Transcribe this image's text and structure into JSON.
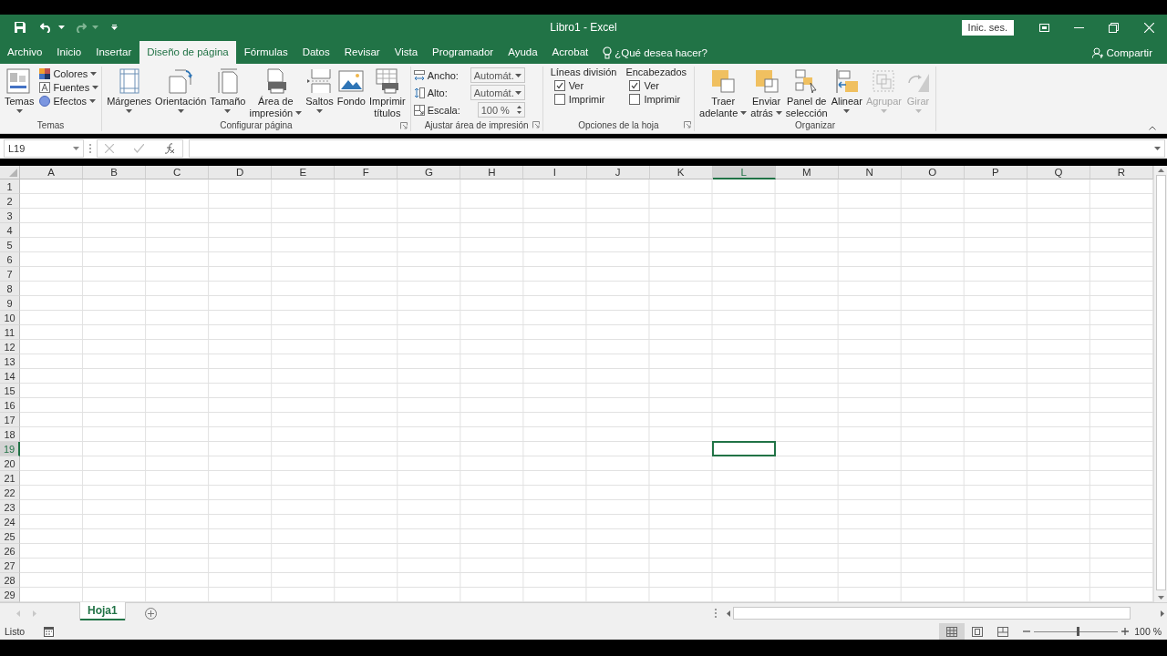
{
  "window": {
    "title": "Libro1 - Excel",
    "sign_in": "Inic. ses."
  },
  "tabs": [
    {
      "label": "Archivo",
      "selected": false
    },
    {
      "label": "Inicio",
      "selected": false
    },
    {
      "label": "Insertar",
      "selected": false
    },
    {
      "label": "Diseño de página",
      "selected": true
    },
    {
      "label": "Fórmulas",
      "selected": false
    },
    {
      "label": "Datos",
      "selected": false
    },
    {
      "label": "Revisar",
      "selected": false
    },
    {
      "label": "Vista",
      "selected": false
    },
    {
      "label": "Programador",
      "selected": false
    },
    {
      "label": "Ayuda",
      "selected": false
    },
    {
      "label": "Acrobat",
      "selected": false
    }
  ],
  "tell_me": "¿Qué desea hacer?",
  "share": "Compartir",
  "ribbon": {
    "groups": [
      {
        "label": "Temas",
        "launcher": false,
        "items": [
          {
            "kind": "large",
            "lines": [
              "Temas"
            ],
            "dropdown": true,
            "disabled": false
          },
          {
            "kind": "stack",
            "items": [
              {
                "label": "Colores",
                "dropdown": true
              },
              {
                "label": "Fuentes",
                "dropdown": true
              },
              {
                "label": "Efectos",
                "dropdown": true
              }
            ]
          }
        ]
      },
      {
        "label": "Configurar página",
        "launcher": true,
        "items": [
          {
            "kind": "large",
            "lines": [
              "Márgenes"
            ],
            "dropdown": true,
            "disabled": false
          },
          {
            "kind": "large",
            "lines": [
              "Orientación"
            ],
            "dropdown": true,
            "disabled": false
          },
          {
            "kind": "large",
            "lines": [
              "Tamaño"
            ],
            "dropdown": true,
            "disabled": false
          },
          {
            "kind": "large",
            "lines": [
              "Área de",
              "impresión"
            ],
            "dropdown": true,
            "disabled": false
          },
          {
            "kind": "large",
            "lines": [
              "Saltos"
            ],
            "dropdown": true,
            "disabled": false
          },
          {
            "kind": "large",
            "lines": [
              "Fondo"
            ],
            "dropdown": false,
            "disabled": false
          },
          {
            "kind": "large",
            "lines": [
              "Imprimir",
              "títulos"
            ],
            "dropdown": false,
            "disabled": false
          }
        ]
      },
      {
        "label": "Ajustar área de impresión",
        "launcher": true,
        "items": [
          {
            "kind": "fields",
            "items": [
              {
                "kind": "dropdown",
                "label": "Ancho:",
                "value": "Automát."
              },
              {
                "kind": "dropdown",
                "label": "Alto:",
                "value": "Automát."
              },
              {
                "kind": "spin",
                "label": "Escala:",
                "value": "100 %"
              }
            ]
          }
        ]
      },
      {
        "label": "Opciones de la hoja",
        "launcher": true,
        "items": [
          {
            "kind": "checks",
            "heading": "Líneas división",
            "checks": [
              {
                "label": "Ver",
                "checked": true
              },
              {
                "label": "Imprimir",
                "checked": false
              }
            ]
          },
          {
            "kind": "checks",
            "heading": "Encabezados",
            "checks": [
              {
                "label": "Ver",
                "checked": true
              },
              {
                "label": "Imprimir",
                "checked": false
              }
            ]
          }
        ]
      },
      {
        "label": "Organizar",
        "launcher": false,
        "items": [
          {
            "kind": "large",
            "lines": [
              "Traer",
              "adelante"
            ],
            "dropdown": true,
            "disabled": false
          },
          {
            "kind": "large",
            "lines": [
              "Enviar",
              "atrás"
            ],
            "dropdown": true,
            "disabled": false
          },
          {
            "kind": "large",
            "lines": [
              "Panel de",
              "selección"
            ],
            "dropdown": false,
            "disabled": false
          },
          {
            "kind": "large",
            "lines": [
              "Alinear"
            ],
            "dropdown": true,
            "disabled": false
          },
          {
            "kind": "large",
            "lines": [
              "Agrupar"
            ],
            "dropdown": true,
            "disabled": true
          },
          {
            "kind": "large",
            "lines": [
              "Girar"
            ],
            "dropdown": true,
            "disabled": true
          }
        ]
      }
    ]
  },
  "formula_bar": {
    "name_box": "L19"
  },
  "sheet": {
    "columns": [
      {
        "label": "A",
        "selected": false
      },
      {
        "label": "B",
        "selected": false
      },
      {
        "label": "C",
        "selected": false
      },
      {
        "label": "D",
        "selected": false
      },
      {
        "label": "E",
        "selected": false
      },
      {
        "label": "F",
        "selected": false
      },
      {
        "label": "G",
        "selected": false
      },
      {
        "label": "H",
        "selected": false
      },
      {
        "label": "I",
        "selected": false
      },
      {
        "label": "J",
        "selected": false
      },
      {
        "label": "K",
        "selected": false
      },
      {
        "label": "L",
        "selected": true
      },
      {
        "label": "M",
        "selected": false
      },
      {
        "label": "N",
        "selected": false
      },
      {
        "label": "O",
        "selected": false
      },
      {
        "label": "P",
        "selected": false
      },
      {
        "label": "Q",
        "selected": false
      },
      {
        "label": "R",
        "selected": false
      }
    ],
    "rows": [
      {
        "label": "1",
        "selected": false
      },
      {
        "label": "2",
        "selected": false
      },
      {
        "label": "3",
        "selected": false
      },
      {
        "label": "4",
        "selected": false
      },
      {
        "label": "5",
        "selected": false
      },
      {
        "label": "6",
        "selected": false
      },
      {
        "label": "7",
        "selected": false
      },
      {
        "label": "8",
        "selected": false
      },
      {
        "label": "9",
        "selected": false
      },
      {
        "label": "10",
        "selected": false
      },
      {
        "label": "11",
        "selected": false
      },
      {
        "label": "12",
        "selected": false
      },
      {
        "label": "13",
        "selected": false
      },
      {
        "label": "14",
        "selected": false
      },
      {
        "label": "15",
        "selected": false
      },
      {
        "label": "16",
        "selected": false
      },
      {
        "label": "17",
        "selected": false
      },
      {
        "label": "18",
        "selected": false
      },
      {
        "label": "19",
        "selected": true
      },
      {
        "label": "20",
        "selected": false
      },
      {
        "label": "21",
        "selected": false
      },
      {
        "label": "22",
        "selected": false
      },
      {
        "label": "23",
        "selected": false
      },
      {
        "label": "24",
        "selected": false
      },
      {
        "label": "25",
        "selected": false
      },
      {
        "label": "26",
        "selected": false
      },
      {
        "label": "27",
        "selected": false
      },
      {
        "label": "28",
        "selected": false
      },
      {
        "label": "29",
        "selected": false
      }
    ]
  },
  "sheet_tabs": [
    {
      "label": "Hoja1",
      "selected": true
    }
  ],
  "status_bar": {
    "text": "Listo",
    "views": [
      {
        "kind": "normal",
        "selected": true
      },
      {
        "kind": "page_layout",
        "selected": false
      },
      {
        "kind": "page_break",
        "selected": false
      }
    ],
    "zoom": {
      "level": 0.52,
      "reading": "100 %"
    }
  }
}
